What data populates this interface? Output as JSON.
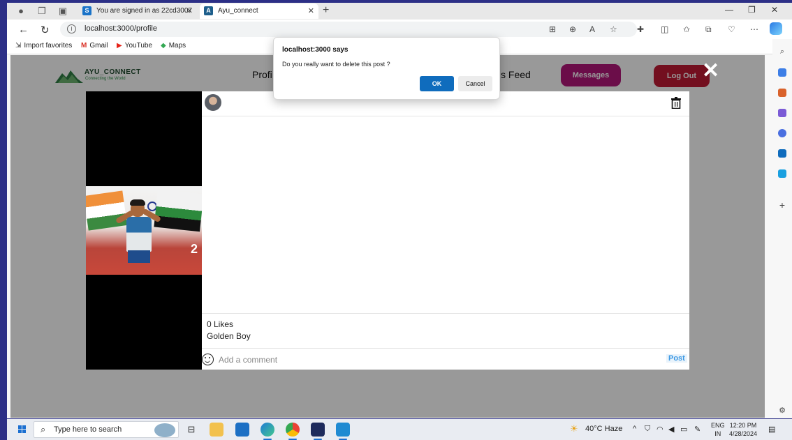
{
  "browser": {
    "tabs": [
      {
        "label": "You are signed in as 22cd3007",
        "favicon": "S",
        "favicon_color": "#1a73c8"
      },
      {
        "label": "Ayu_connect",
        "favicon": "A",
        "favicon_color": "#1e5f8c"
      }
    ],
    "address": "localhost:3000/profile",
    "bookmarks": [
      {
        "label": "Import favorites",
        "icon": "import-icon"
      },
      {
        "label": "Gmail",
        "icon": "gmail-icon"
      },
      {
        "label": "YouTube",
        "icon": "youtube-icon"
      },
      {
        "label": "Maps",
        "icon": "maps-icon"
      }
    ]
  },
  "app": {
    "logo_name": "AYU_CONNECT",
    "logo_tagline": "Connecting the World",
    "nav_left": "Profi",
    "nav_right": "s Feed",
    "messages_label": "Messages",
    "logout_label": "Log Out",
    "close_symbol": "✕"
  },
  "post": {
    "likes": "0 Likes",
    "caption": "Golden Boy",
    "comment_placeholder": "Add a comment",
    "post_label": "Post",
    "photo_bib": "2"
  },
  "alert": {
    "title": "localhost:3000 says",
    "message": "Do you really want to delete this post ?",
    "ok_label": "OK",
    "cancel_label": "Cancel"
  },
  "taskbar": {
    "search_placeholder": "Type here to search",
    "weather": "40°C  Haze",
    "lang_top": "ENG",
    "lang_bottom": "IN",
    "time": "12:20 PM",
    "date": "4/28/2024"
  },
  "colors": {
    "messages_button": "#b3177a",
    "logout_button": "#c01a34",
    "ok_button": "#0f6cbd",
    "post_link": "#3b98e4"
  }
}
